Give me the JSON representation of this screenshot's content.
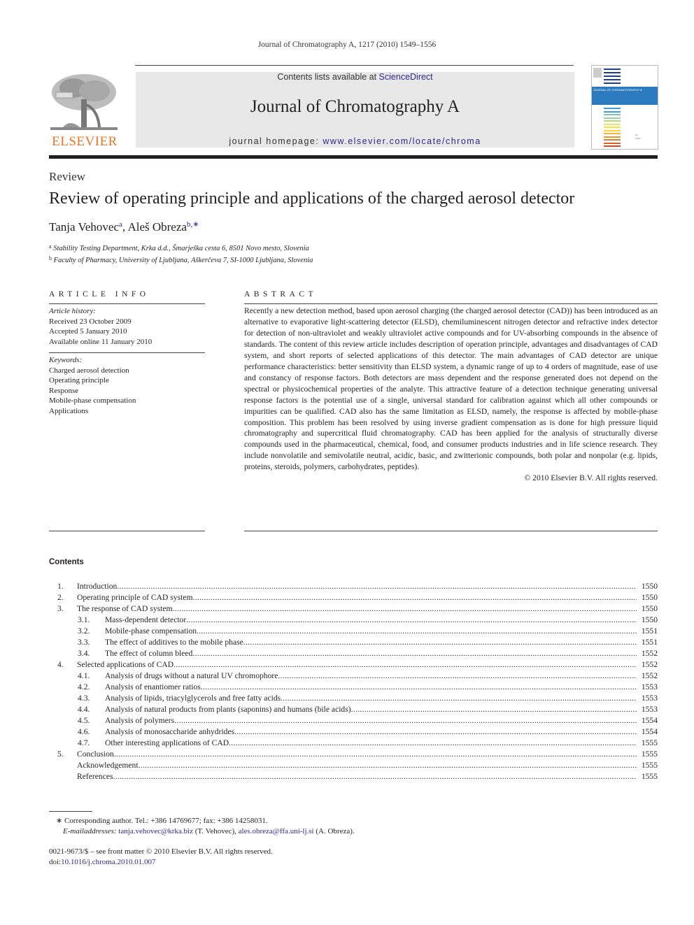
{
  "running_head": "Journal of Chromatography A, 1217 (2010) 1549–1556",
  "masthead": {
    "publisher_logo": "ELSEVIER",
    "contents_prefix": "Contents lists available at ",
    "contents_link": "ScienceDirect",
    "journal_title": "Journal of Chromatography A",
    "homepage_prefix": "journal homepage: ",
    "homepage_url": "www.elsevier.com/locate/chroma",
    "cover_title": "JOURNAL OF CHROMATOGRAPHY A",
    "brand_color": "#e87722",
    "link_color": "#2a2a8a"
  },
  "article": {
    "type": "Review",
    "title": "Review of operating principle and applications of the charged aerosol detector",
    "authors": [
      {
        "name": "Tanja Vehovec",
        "marks": "a"
      },
      {
        "name": "Aleš Obreza",
        "marks": "b,∗"
      }
    ],
    "affiliations": [
      {
        "mark": "a",
        "text": "Stability Testing Department, Krka d.d., Šmarješka cesta 6, 8501 Novo mesto, Slovenia"
      },
      {
        "mark": "b",
        "text": "Faculty of Pharmacy, University of Ljubljana, Aškerčeva 7, SI-1000 Ljubljana, Slovenia"
      }
    ]
  },
  "article_info": {
    "heading": "ARTICLE INFO",
    "history_label": "Article history:",
    "history": [
      "Received 23 October 2009",
      "Accepted 5 January 2010",
      "Available online 11 January 2010"
    ],
    "keywords_label": "Keywords:",
    "keywords": [
      "Charged aerosol detection",
      "Operating principle",
      "Response",
      "Mobile-phase compensation",
      "Applications"
    ]
  },
  "abstract": {
    "heading": "ABSTRACT",
    "text": "Recently a new detection method, based upon aerosol charging (the charged aerosol detector (CAD)) has been introduced as an alternative to evaporative light-scattering detector (ELSD), chemiluminescent nitrogen detector and refractive index detector for detection of non-ultraviolet and weakly ultraviolet active compounds and for UV-absorbing compounds in the absence of standards. The content of this review article includes description of operation principle, advantages and disadvantages of CAD system, and short reports of selected applications of this detector. The main advantages of CAD detector are unique performance characteristics: better sensitivity than ELSD system, a dynamic range of up to 4 orders of magnitude, ease of use and constancy of response factors. Both detectors are mass dependent and the response generated does not depend on the spectral or physicochemical properties of the analyte. This attractive feature of a detection technique generating universal response factors is the potential use of a single, universal standard for calibration against which all other compounds or impurities can be qualified. CAD also has the same limitation as ELSD, namely, the response is affected by mobile-phase composition. This problem has been resolved by using inverse gradient compensation as is done for high pressure liquid chromatography and supercritical fluid chromatography. CAD has been applied for the analysis of structurally diverse compounds used in the pharmaceutical, chemical, food, and consumer products industries and in life science research. They include nonvolatile and semivolatile neutral, acidic, basic, and zwitterionic compounds, both polar and nonpolar (e.g. lipids, proteins, steroids, polymers, carbohydrates, peptides).",
    "copyright": "© 2010 Elsevier B.V. All rights reserved."
  },
  "contents": {
    "heading": "Contents",
    "items": [
      {
        "level": 1,
        "num": "1.",
        "label": "Introduction",
        "page": "1550"
      },
      {
        "level": 1,
        "num": "2.",
        "label": "Operating principle of CAD system",
        "page": "1550"
      },
      {
        "level": 1,
        "num": "3.",
        "label": "The response of CAD system",
        "page": "1550"
      },
      {
        "level": 2,
        "num": "3.1.",
        "label": "Mass-dependent detector",
        "page": "1550"
      },
      {
        "level": 2,
        "num": "3.2.",
        "label": "Mobile-phase compensation",
        "page": "1551"
      },
      {
        "level": 2,
        "num": "3.3.",
        "label": "The effect of additives to the mobile phase",
        "page": "1551"
      },
      {
        "level": 2,
        "num": "3.4.",
        "label": "The effect of column bleed",
        "page": "1552"
      },
      {
        "level": 1,
        "num": "4.",
        "label": "Selected applications of CAD",
        "page": "1552"
      },
      {
        "level": 2,
        "num": "4.1.",
        "label": "Analysis of drugs without a natural UV chromophore",
        "page": "1552"
      },
      {
        "level": 2,
        "num": "4.2.",
        "label": "Analysis of enantiomer ratios",
        "page": "1553"
      },
      {
        "level": 2,
        "num": "4.3.",
        "label": "Analysis of lipids, triacylglycerols and free fatty acids",
        "page": "1553"
      },
      {
        "level": 2,
        "num": "4.4.",
        "label": "Analysis of natural products from plants (saponins) and humans (bile acids)",
        "page": "1553"
      },
      {
        "level": 2,
        "num": "4.5.",
        "label": "Analysis of polymers",
        "page": "1554"
      },
      {
        "level": 2,
        "num": "4.6.",
        "label": "Analysis of monosaccharide anhydrides",
        "page": "1554"
      },
      {
        "level": 2,
        "num": "4.7.",
        "label": "Other interesting applications of CAD",
        "page": "1555"
      },
      {
        "level": 1,
        "num": "5.",
        "label": "Conclusion",
        "page": "1555"
      },
      {
        "level": 0,
        "num": "",
        "label": "Acknowledgement",
        "page": "1555"
      },
      {
        "level": 0,
        "num": "",
        "label": "References",
        "page": "1555"
      }
    ]
  },
  "footnotes": {
    "corresponding": "∗ Corresponding author. Tel.: +386 14769677; fax: +386 14258031.",
    "email_label": "E-mailaddresses:",
    "emails": [
      {
        "address": "tanja.vehovec@krka.biz",
        "owner": "(T. Vehovec),"
      },
      {
        "address": "ales.obreza@ffa.uni-lj.si",
        "owner": "(A. Obreza)."
      }
    ]
  },
  "front_matter": {
    "issn_line": "0021-9673/$ – see front matter © 2010 Elsevier B.V. All rights reserved.",
    "doi_prefix": "doi:",
    "doi": "10.1016/j.chroma.2010.01.007"
  }
}
